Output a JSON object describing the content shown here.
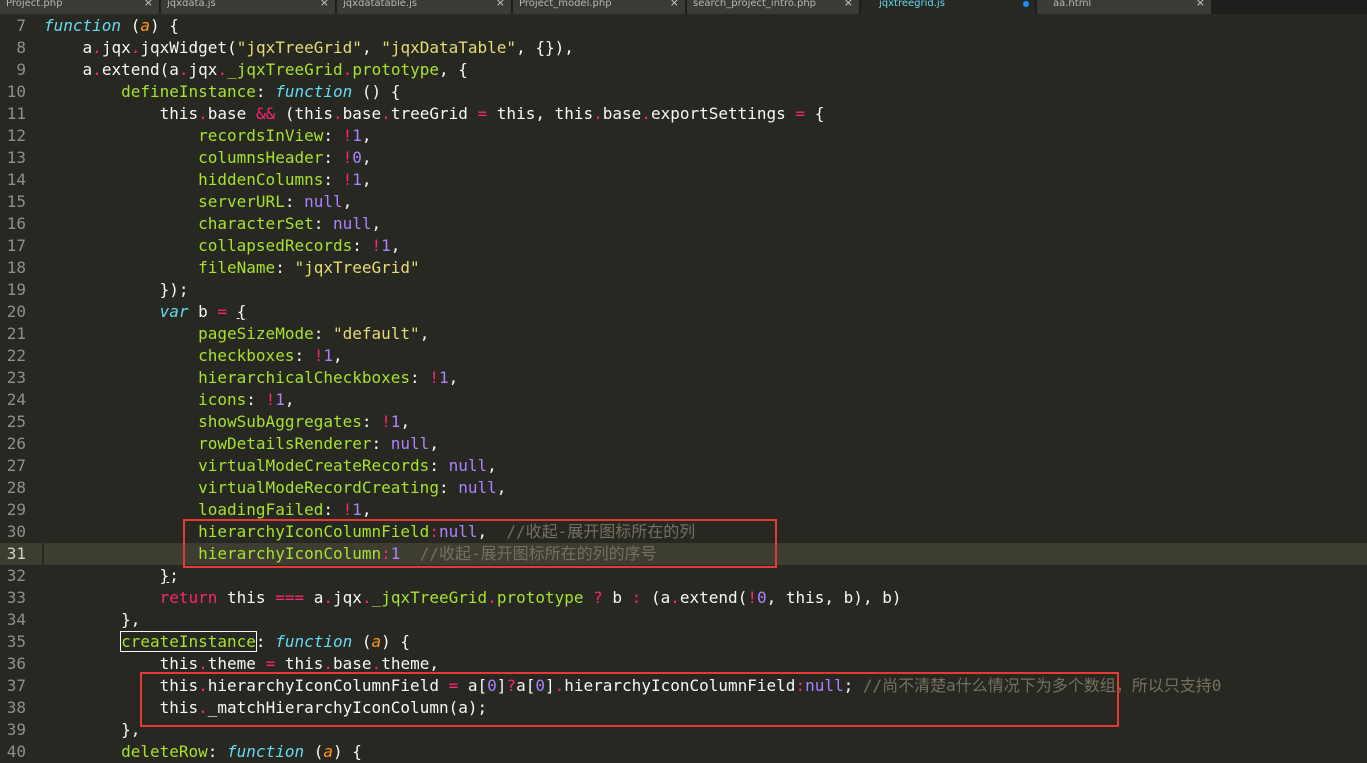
{
  "tabs": [
    {
      "label": "Project.php"
    },
    {
      "label": "jqxdata.js"
    },
    {
      "label": "jqxdatatable.js"
    },
    {
      "label": "Project_model.php"
    },
    {
      "label": "search_project_intro.php"
    },
    {
      "label": "jqxtreegrid.js"
    },
    {
      "label": "aa.html"
    }
  ],
  "close_glyph": "×",
  "line_numbers": [
    "7",
    "8",
    "9",
    "10",
    "11",
    "12",
    "13",
    "14",
    "15",
    "16",
    "17",
    "18",
    "19",
    "20",
    "21",
    "22",
    "23",
    "24",
    "25",
    "26",
    "27",
    "28",
    "29",
    "30",
    "31",
    "32",
    "33",
    "34",
    "35",
    "36",
    "37",
    "38",
    "39",
    "40"
  ],
  "code": {
    "indent1": "    ",
    "indent2": "        ",
    "indent3": "            ",
    "indent4": "                ",
    "indent5": "                    ",
    "ln7": {
      "t1": "function",
      "t2": " (",
      "t3": "a",
      "t4": ") {"
    },
    "ln8": {
      "t1": "a",
      "t2": ".",
      "t3": "jqx",
      "t4": ".",
      "t5": "jqxWidget",
      "t6": "(",
      "t7": "\"jqxTreeGrid\"",
      "t8": ", ",
      "t9": "\"jqxDataTable\"",
      "t10": ", {}),"
    },
    "ln9": {
      "t1": "a",
      "t2": ".",
      "t3": "extend",
      "t4": "(",
      "t5": "a",
      "t6": ".",
      "t7": "jqx",
      "t8": ".",
      "t9": "_jqxTreeGrid",
      "t10": ".",
      "t11": "prototype",
      "t12": ", {"
    },
    "ln10": {
      "t1": "defineInstance",
      "t2": ": ",
      "t3": "function",
      "t4": " () {"
    },
    "ln11": {
      "t1": "this",
      "t2": ".",
      "t3": "base",
      "t4": " ",
      "t5": "&&",
      "t6": " (",
      "t7": "this",
      "t8": ".",
      "t9": "base",
      "t10": ".",
      "t11": "treeGrid",
      "t12": " ",
      "t13": "=",
      "t14": " ",
      "t15": "this",
      "t16": ", ",
      "t17": "this",
      "t18": ".",
      "t19": "base",
      "t20": ".",
      "t21": "exportSettings",
      "t22": " ",
      "t23": "=",
      "t24": " {"
    },
    "ln12": {
      "k": "recordsInView",
      "s": ": ",
      "o": "!",
      "v": "1",
      "e": ","
    },
    "ln13": {
      "k": "columnsHeader",
      "s": ": ",
      "o": "!",
      "v": "0",
      "e": ","
    },
    "ln14": {
      "k": "hiddenColumns",
      "s": ": ",
      "o": "!",
      "v": "1",
      "e": ","
    },
    "ln15": {
      "k": "serverURL",
      "s": ": ",
      "v": "null",
      "e": ","
    },
    "ln16": {
      "k": "characterSet",
      "s": ": ",
      "v": "null",
      "e": ","
    },
    "ln17": {
      "k": "collapsedRecords",
      "s": ": ",
      "o": "!",
      "v": "1",
      "e": ","
    },
    "ln18": {
      "k": "fileName",
      "s": ": ",
      "v": "\"jqxTreeGrid\""
    },
    "ln19": {
      "t": "});"
    },
    "ln20": {
      "t1": "var",
      "t2": " b ",
      "t3": "=",
      "t4": " ",
      "t5": "{"
    },
    "ln21": {
      "k": "pageSizeMode",
      "s": ": ",
      "v": "\"default\"",
      "e": ","
    },
    "ln22": {
      "k": "checkboxes",
      "s": ": ",
      "o": "!",
      "v": "1",
      "e": ","
    },
    "ln23": {
      "k": "hierarchicalCheckboxes",
      "s": ": ",
      "o": "!",
      "v": "1",
      "e": ","
    },
    "ln24": {
      "k": "icons",
      "s": ": ",
      "o": "!",
      "v": "1",
      "e": ","
    },
    "ln25": {
      "k": "showSubAggregates",
      "s": ": ",
      "o": "!",
      "v": "1",
      "e": ","
    },
    "ln26": {
      "k": "rowDetailsRenderer",
      "s": ": ",
      "v": "null",
      "e": ","
    },
    "ln27": {
      "k": "virtualModeCreateRecords",
      "s": ": ",
      "v": "null",
      "e": ","
    },
    "ln28": {
      "k": "virtualModeRecordCreating",
      "s": ": ",
      "v": "null",
      "e": ","
    },
    "ln29": {
      "k": "loadingFailed",
      "s": ": ",
      "o": "!",
      "v": "1",
      "e": ","
    },
    "ln30": {
      "k": "hierarchyIconColumnField",
      "s": ":",
      "v": "null",
      "e": ",  ",
      "c": "//收起-展开图标所在的列"
    },
    "ln31": {
      "k": "hierarchyIconColumn",
      "s": ":",
      "v": "1",
      "e": "  ",
      "c": "//收起-展开图标所在的列的序号"
    },
    "ln32": {
      "t1": "}",
      "t2": ";"
    },
    "ln33": {
      "t1": "return",
      "t2": " ",
      "t3": "this",
      "t4": " ",
      "t5": "===",
      "t6": " ",
      "t7": "a",
      "t8": ".",
      "t9": "jqx",
      "t10": ".",
      "t11": "_jqxTreeGrid",
      "t12": ".",
      "t13": "prototype",
      "t14": " ",
      "t15": "?",
      "t16": " b ",
      "t17": ":",
      "t18": " (",
      "t19": "a",
      "t20": ".",
      "t21": "extend",
      "t22": "(",
      "t23": "!",
      "t24": "0",
      "t25": ", ",
      "t26": "this",
      "t27": ", b), b)"
    },
    "ln34": {
      "t": "},"
    },
    "ln35": {
      "t1": "createInstance",
      "t2": ": ",
      "t3": "function",
      "t4": " (",
      "t5": "a",
      "t6": ") {"
    },
    "ln36": {
      "t1": "this",
      "t2": ".",
      "t3": "theme",
      "t4": " ",
      "t5": "=",
      "t6": " ",
      "t7": "this",
      "t8": ".",
      "t9": "base",
      "t10": ".",
      "t11": "theme",
      "t12": ","
    },
    "ln37": {
      "t1": "this",
      "t2": ".",
      "t3": "hierarchyIconColumnField",
      "t4": " ",
      "t5": "=",
      "t6": " a[",
      "t7": "0",
      "t8": "]",
      "t9": "?",
      "t10": "a[",
      "t11": "0",
      "t12": "]",
      "t13": ".",
      "t14": "hierarchyIconColumnField",
      "t15": ":",
      "t16": "null",
      "t17": "; ",
      "t18": "//尚不清楚a什么情况下为多个数组，所以只支持0"
    },
    "ln38": {
      "t1": "this",
      "t2": ".",
      "t3": "_matchHierarchyIconColumn",
      "t4": "(a);"
    },
    "ln39": {
      "t": "},"
    },
    "ln40": {
      "t1": "deleteRow",
      "t2": ": ",
      "t3": "function",
      "t4": " (",
      "t5": "a",
      "t6": ") {"
    }
  },
  "colors": {
    "background": "#272822",
    "highlight_box": "#e53935",
    "active_tab_text": "#66d9ef",
    "unsaved_dot": "#1e90ff"
  }
}
